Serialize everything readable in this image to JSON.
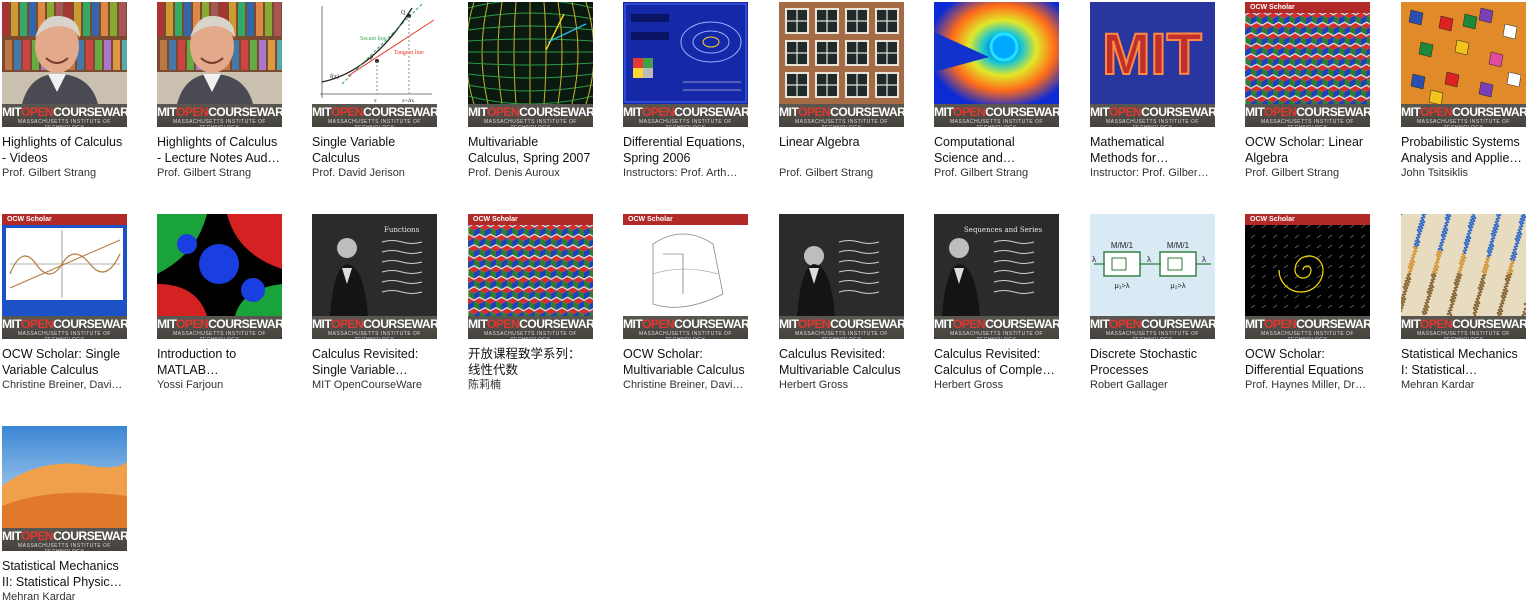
{
  "brand": {
    "prefix": "MIT",
    "highlight": "OPEN",
    "suffix": "COURSEWARE",
    "subtitle": "MASSACHUSETTS INSTITUTE OF TECHNOLOGY",
    "scholar_label": "OCW Scholar"
  },
  "courses": [
    {
      "title": "Highlights of Calculus - Videos",
      "author": "Prof. Gilbert Strang",
      "art": "portrait-strang"
    },
    {
      "title": "Highlights of Calculus - Lecture Notes Aud…",
      "author": "Prof. Gilbert Strang",
      "art": "portrait-strang"
    },
    {
      "title": "Single Variable Calculus",
      "author": "Prof. David Jerison",
      "art": "secant-plot",
      "art_text": {
        "secant": "Secant line",
        "tangent": "Tangent line",
        "fx": "f(x)",
        "p": "P",
        "q": "Q",
        "x0": "x",
        "x1": "x+Δx"
      }
    },
    {
      "title": "Multivariable Calculus, Spring 2007",
      "author": "Prof. Denis Auroux",
      "art": "vector-field"
    },
    {
      "title": "Differential Equations, Spring 2006",
      "author": "Instructors: Prof. Arth…",
      "art": "mathlet"
    },
    {
      "title": "Linear Algebra",
      "author": "Prof. Gilbert Strang",
      "art": "building"
    },
    {
      "title": "Computational Science and…",
      "author": "Prof. Gilbert Strang",
      "art": "mesh"
    },
    {
      "title": "Mathematical Methods for…",
      "author": "Instructor: Prof. Gilber…",
      "art": "mit-letters",
      "art_text": {
        "letters": "MIT"
      }
    },
    {
      "title": "OCW Scholar: Linear Algebra",
      "author": "Prof. Gilbert Strang",
      "art": "cubes-scholar"
    },
    {
      "title": "Probabilistic Systems Analysis and Applie…",
      "author": "John Tsitsiklis",
      "art": "dice"
    },
    {
      "title": "OCW Scholar: Single Variable Calculus",
      "author": "Christine Breiner, Davi…",
      "art": "sine-scholar"
    },
    {
      "title": "Introduction to MATLAB…",
      "author": "Yossi Farjoun",
      "art": "fractal"
    },
    {
      "title": "Calculus Revisited: Single Variable…",
      "author": "MIT OpenCourseWare",
      "art": "blackboard-1",
      "art_text": {
        "board": "Functions"
      }
    },
    {
      "title": "开放课程致学系列：线性代数",
      "author": "陈莉楠",
      "art": "cubes-scholar"
    },
    {
      "title": "OCW Scholar: Multivariable Calculus",
      "author": "Christine Breiner, Davi…",
      "art": "surface-scholar"
    },
    {
      "title": "Calculus Revisited: Multivariable Calculus",
      "author": "Herbert Gross",
      "art": "blackboard-2"
    },
    {
      "title": "Calculus Revisited: Calculus of Comple…",
      "author": "Herbert Gross",
      "art": "blackboard-3",
      "art_text": {
        "board": "Sequences and Series"
      }
    },
    {
      "title": "Discrete Stochastic Processes",
      "author": "Robert Gallager",
      "art": "queue",
      "art_text": {
        "mm1": "M/M/1",
        "lam": "λ",
        "m1": "μ₁>λ",
        "m2": "μ₂>λ"
      }
    },
    {
      "title": "OCW Scholar: Differential Equations",
      "author": "Prof. Haynes Miller, Dr…",
      "art": "spiral-scholar"
    },
    {
      "title": "Statistical Mechanics I: Statistical…",
      "author": "Mehran Kardar",
      "art": "dots"
    },
    {
      "title": "Statistical Mechanics II: Statistical Physic…",
      "author": "Mehran Kardar",
      "art": "dunes"
    }
  ]
}
